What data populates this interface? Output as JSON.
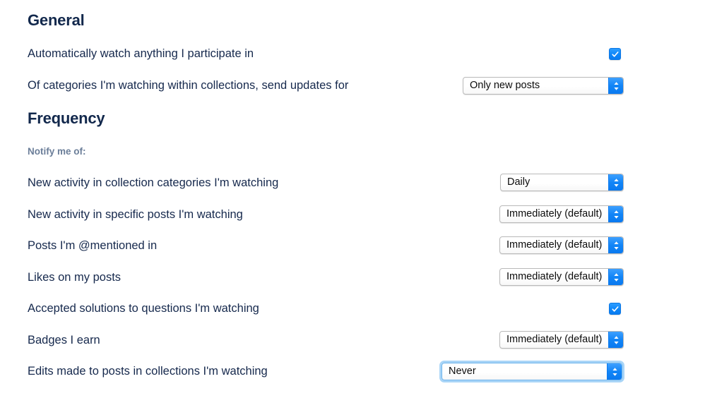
{
  "sections": {
    "general": {
      "heading": "General",
      "rows": [
        {
          "label": "Automatically watch anything I participate in",
          "control": "checkbox",
          "checked": true
        },
        {
          "label": "Of categories I'm watching within collections, send updates for",
          "control": "select",
          "value": "Only new posts"
        }
      ]
    },
    "frequency": {
      "heading": "Frequency",
      "sub_label": "Notify me of:",
      "rows": [
        {
          "label": "New activity in collection categories I'm watching",
          "control": "select",
          "value": "Daily"
        },
        {
          "label": "New activity in specific posts I'm watching",
          "control": "select",
          "value": "Immediately (default)"
        },
        {
          "label": "Posts I'm @mentioned in",
          "control": "select",
          "value": "Immediately (default)"
        },
        {
          "label": "Likes on my posts",
          "control": "select",
          "value": "Immediately (default)"
        },
        {
          "label": "Accepted solutions to questions I'm watching",
          "control": "checkbox",
          "checked": true
        },
        {
          "label": "Badges I earn",
          "control": "select",
          "value": "Immediately (default)"
        },
        {
          "label": "Edits made to posts in collections I'm watching",
          "control": "select",
          "value": "Never",
          "focused": true
        }
      ]
    }
  },
  "icons": {
    "select_stepper": "chevron-up-down-icon",
    "checkbox_mark": "check-icon"
  },
  "colors": {
    "heading_text": "#12284c",
    "label_text": "#16294d",
    "sub_label_text": "#6b7e99",
    "accent_blue": "#0d86f9",
    "focus_ring": "#a9d5f7",
    "page_background": "#ffffff"
  }
}
